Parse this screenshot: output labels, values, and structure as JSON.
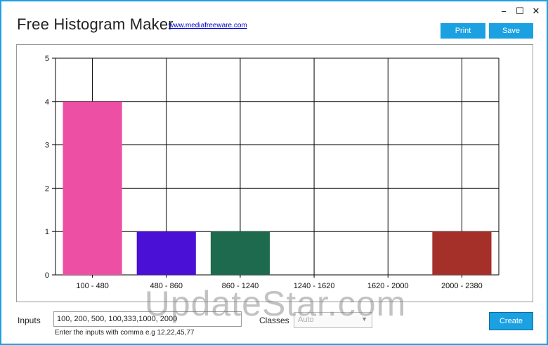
{
  "app": {
    "title": "Free Histogram Maker",
    "link": "www.mediafreeware.com",
    "window_controls": {
      "minimize": "−",
      "maximize": "☐",
      "close": "✕"
    }
  },
  "toolbar": {
    "print_label": "Print",
    "save_label": "Save"
  },
  "chart_data": {
    "type": "bar",
    "categories": [
      "100 - 480",
      "480 - 860",
      "860 - 1240",
      "1240 - 1620",
      "1620 - 2000",
      "2000 - 2380"
    ],
    "values": [
      4,
      1,
      1,
      0,
      0,
      1
    ],
    "colors": [
      "#ec4fa3",
      "#4b10d6",
      "#1e6a4e",
      "#cccccc",
      "#cccccc",
      "#a5302a"
    ],
    "ylim": [
      0,
      5
    ],
    "yticks": [
      "0",
      "1",
      "2",
      "3",
      "4",
      "5"
    ],
    "grid": true
  },
  "inputs": {
    "label": "Inputs",
    "value": "100, 200, 500, 100,333,1000, 2000",
    "hint": "Enter the inputs with comma e.g 12,22,45,77"
  },
  "classes": {
    "label": "Classes",
    "value": "Auto"
  },
  "create_label": "Create",
  "watermark": "UpdateStar.com",
  "theme": {
    "accent": "#1ba1e2"
  }
}
